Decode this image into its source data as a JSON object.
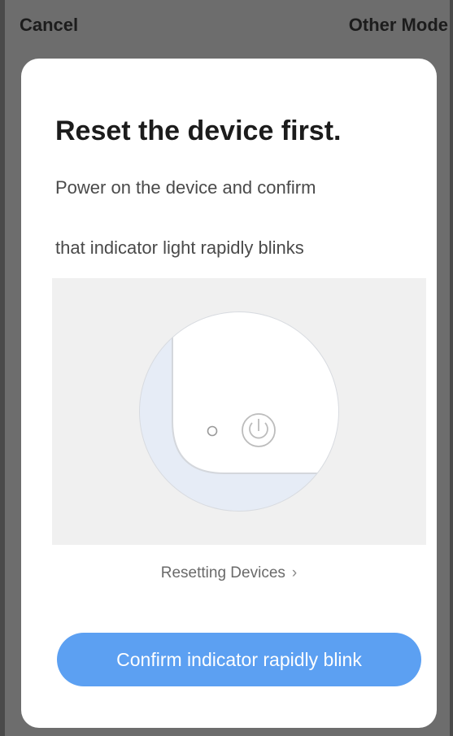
{
  "nav": {
    "cancel_label": "Cancel",
    "other_mode_label": "Other Mode"
  },
  "content": {
    "title": "Reset the device first.",
    "description_line1": "Power on the device and confirm",
    "description_line2": "that indicator light rapidly blinks",
    "resetting_link_label": "Resetting Devices",
    "resetting_link_chevron": "›",
    "confirm_button_label": "Confirm indicator rapidly blink"
  },
  "colors": {
    "accent": "#5ca0f2",
    "card": "#ffffff",
    "illustration_bg": "#f0f0f0",
    "device_highlight": "#e6ecf6"
  },
  "icons": {
    "power": "power-icon",
    "indicator": "indicator-light-icon",
    "chevron": "chevron-right-icon"
  }
}
